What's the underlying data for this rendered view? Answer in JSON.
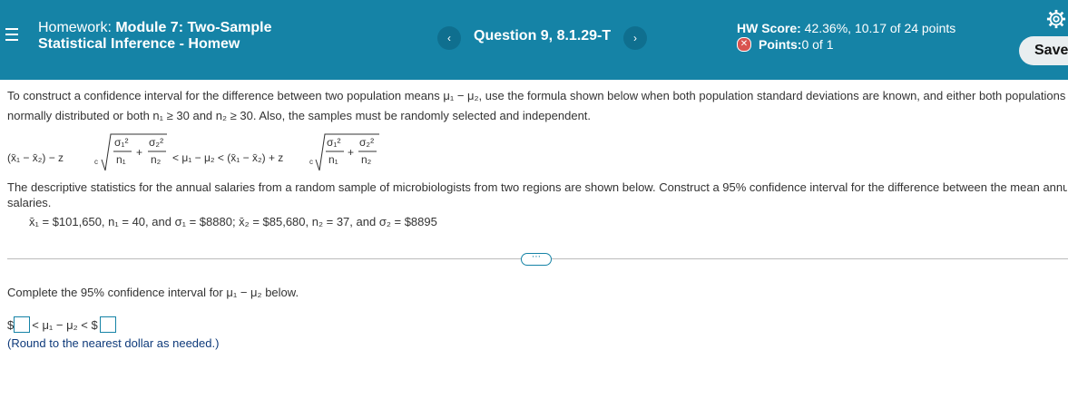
{
  "header": {
    "title_prefix": "Homework:",
    "title_main": " Module 7: Two-Sample",
    "title_line2": "Statistical Inference - Homew",
    "prev_label": "‹",
    "next_label": "›",
    "question": "Question 9, 8.1.29-T",
    "score_label": "HW Score:",
    "score_value": " 42.36%, 10.17 of 24 points",
    "points_label": "Points:",
    "points_value": " 0 of 1",
    "save_label": "Save",
    "icons": [
      "hamburger-menu-icon",
      "chevron-left-icon",
      "chevron-right-icon",
      "error-x-icon",
      "gear-icon"
    ],
    "colors": {
      "bar": "#1583a6",
      "error": "#d9534f"
    }
  },
  "body": {
    "intro_line1": "To construct a confidence interval for the difference between two population means μ₁ − μ₂, use the formula shown below when both population standard deviations are known, and either both populations",
    "intro_line2": "normally distributed or both n₁ ≥ 30 and n₂ ≥ 30. Also, the samples must be randomly selected and independent.",
    "desc_line1": "The descriptive statistics for the annual salaries from a random sample of microbiologists from two regions are shown below. Construct a 95% confidence interval for the difference between the mean annu",
    "desc_line2": "salaries.",
    "stats_line": "x̄₁ = $101,650, n₁ = 40, and σ₁ = $8880; x̄₂ = $85,680, n₂ = 37, and σ₂ = $8895",
    "prompt": "Complete the 95% confidence interval for μ₁ − μ₂ below.",
    "answer_prefix": "$",
    "answer_middle": " < μ₁ − μ₂ < $",
    "round_note": "(Round to the nearest dollar as needed.)",
    "expander_label": "⋯"
  }
}
